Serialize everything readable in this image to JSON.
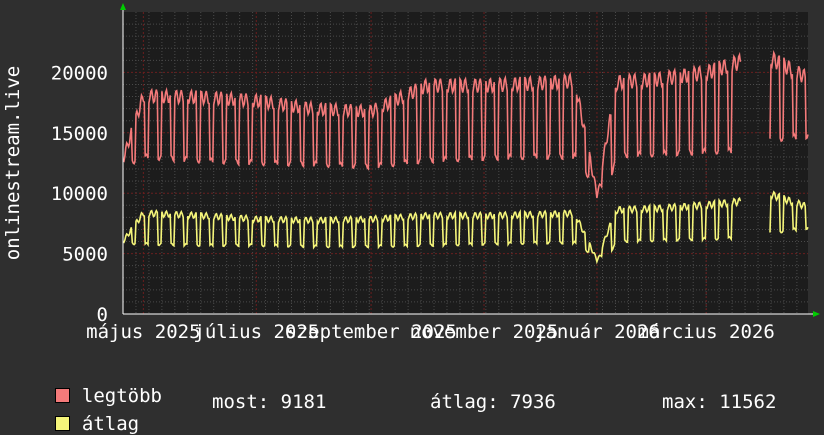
{
  "colors": {
    "background": "#2f2f2f",
    "plot_background": "#1c1c1c",
    "grid_major": "#6a1e1e",
    "grid_minor": "#4a4a4a",
    "max_series": "#f47a7a",
    "avg_series": "#f5f57a",
    "axis_arrow": "#00cc00"
  },
  "legend": {
    "max_label": "legtöbb",
    "avg_label": "átlag"
  },
  "stats": {
    "current_label": "most:",
    "current_value": "9181",
    "average_label": "átlag:",
    "average_value": "7936",
    "max_label": "max:",
    "max_value": "11562"
  },
  "chart_data": {
    "type": "line",
    "title": "",
    "xlabel": "",
    "ylabel": "onlinestream.live",
    "ylim": [
      0,
      25000
    ],
    "yticks": [
      0,
      5000,
      10000,
      15000,
      20000
    ],
    "xlim": [
      "2025-04-20",
      "2026-04-25"
    ],
    "xticks": [
      {
        "label": "május 2025",
        "date": "2025-05-01"
      },
      {
        "label": "július 2025",
        "date": "2025-07-01"
      },
      {
        "label": "szeptember 2025",
        "date": "2025-09-01"
      },
      {
        "label": "november 2025",
        "date": "2025-11-01"
      },
      {
        "label": "január 2026",
        "date": "2026-01-01"
      },
      {
        "label": "március 2026",
        "date": "2026-03-01"
      }
    ],
    "grid": true,
    "series": [
      {
        "name": "legtöbb",
        "gaps": [
          [
            "2026-03-20",
            "2026-04-04"
          ]
        ],
        "points": [
          [
            "2025-04-20",
            13200
          ],
          [
            "2025-05-01",
            18600
          ],
          [
            "2025-06-01",
            18500
          ],
          [
            "2025-07-01",
            18200
          ],
          [
            "2025-08-01",
            17500
          ],
          [
            "2025-09-01",
            17300
          ],
          [
            "2025-10-01",
            19500
          ],
          [
            "2025-11-01",
            19500
          ],
          [
            "2025-12-01",
            19700
          ],
          [
            "2025-12-20",
            19900
          ],
          [
            "2026-01-01",
            10200
          ],
          [
            "2026-01-08",
            16500
          ],
          [
            "2026-01-12",
            19800
          ],
          [
            "2026-02-01",
            20000
          ],
          [
            "2026-03-01",
            20600
          ],
          [
            "2026-03-19",
            21500
          ],
          [
            "2026-04-05",
            21800
          ],
          [
            "2026-04-24",
            20200
          ]
        ],
        "low_points": [
          [
            "2025-04-20",
            12000
          ],
          [
            "2025-05-01",
            12800
          ],
          [
            "2025-06-01",
            12500
          ],
          [
            "2025-07-01",
            12300
          ],
          [
            "2025-08-01",
            12200
          ],
          [
            "2025-09-01",
            12000
          ],
          [
            "2025-10-01",
            12500
          ],
          [
            "2025-11-01",
            12700
          ],
          [
            "2025-12-01",
            12800
          ],
          [
            "2025-12-20",
            12800
          ],
          [
            "2026-01-01",
            10200
          ],
          [
            "2026-01-08",
            11000
          ],
          [
            "2026-01-12",
            12900
          ],
          [
            "2026-02-01",
            13000
          ],
          [
            "2026-03-01",
            13200
          ],
          [
            "2026-03-19",
            13300
          ],
          [
            "2026-04-05",
            14200
          ],
          [
            "2026-04-24",
            14500
          ]
        ]
      },
      {
        "name": "átlag",
        "gaps": [
          [
            "2026-03-20",
            "2026-04-04"
          ]
        ],
        "points": [
          [
            "2025-04-20",
            6200
          ],
          [
            "2025-05-01",
            8600
          ],
          [
            "2025-06-01",
            8400
          ],
          [
            "2025-07-01",
            8100
          ],
          [
            "2025-08-01",
            8000
          ],
          [
            "2025-09-01",
            8100
          ],
          [
            "2025-10-01",
            8400
          ],
          [
            "2025-11-01",
            8400
          ],
          [
            "2025-12-01",
            8500
          ],
          [
            "2025-12-20",
            8600
          ],
          [
            "2026-01-01",
            4600
          ],
          [
            "2026-01-08",
            7500
          ],
          [
            "2026-01-12",
            8900
          ],
          [
            "2026-02-01",
            9000
          ],
          [
            "2026-03-01",
            9300
          ],
          [
            "2026-03-19",
            9600
          ],
          [
            "2026-04-05",
            10200
          ],
          [
            "2026-04-24",
            9181
          ]
        ],
        "low_points": [
          [
            "2025-04-20",
            5800
          ],
          [
            "2025-05-01",
            5700
          ],
          [
            "2025-06-01",
            5600
          ],
          [
            "2025-07-01",
            5600
          ],
          [
            "2025-08-01",
            5500
          ],
          [
            "2025-09-01",
            5500
          ],
          [
            "2025-10-01",
            5600
          ],
          [
            "2025-11-01",
            5700
          ],
          [
            "2025-12-01",
            5800
          ],
          [
            "2025-12-20",
            5800
          ],
          [
            "2026-01-01",
            4600
          ],
          [
            "2026-01-08",
            5000
          ],
          [
            "2026-01-12",
            5900
          ],
          [
            "2026-02-01",
            6000
          ],
          [
            "2026-03-01",
            6100
          ],
          [
            "2026-03-19",
            6200
          ],
          [
            "2026-04-05",
            6600
          ],
          [
            "2026-04-24",
            7000
          ]
        ]
      }
    ]
  }
}
